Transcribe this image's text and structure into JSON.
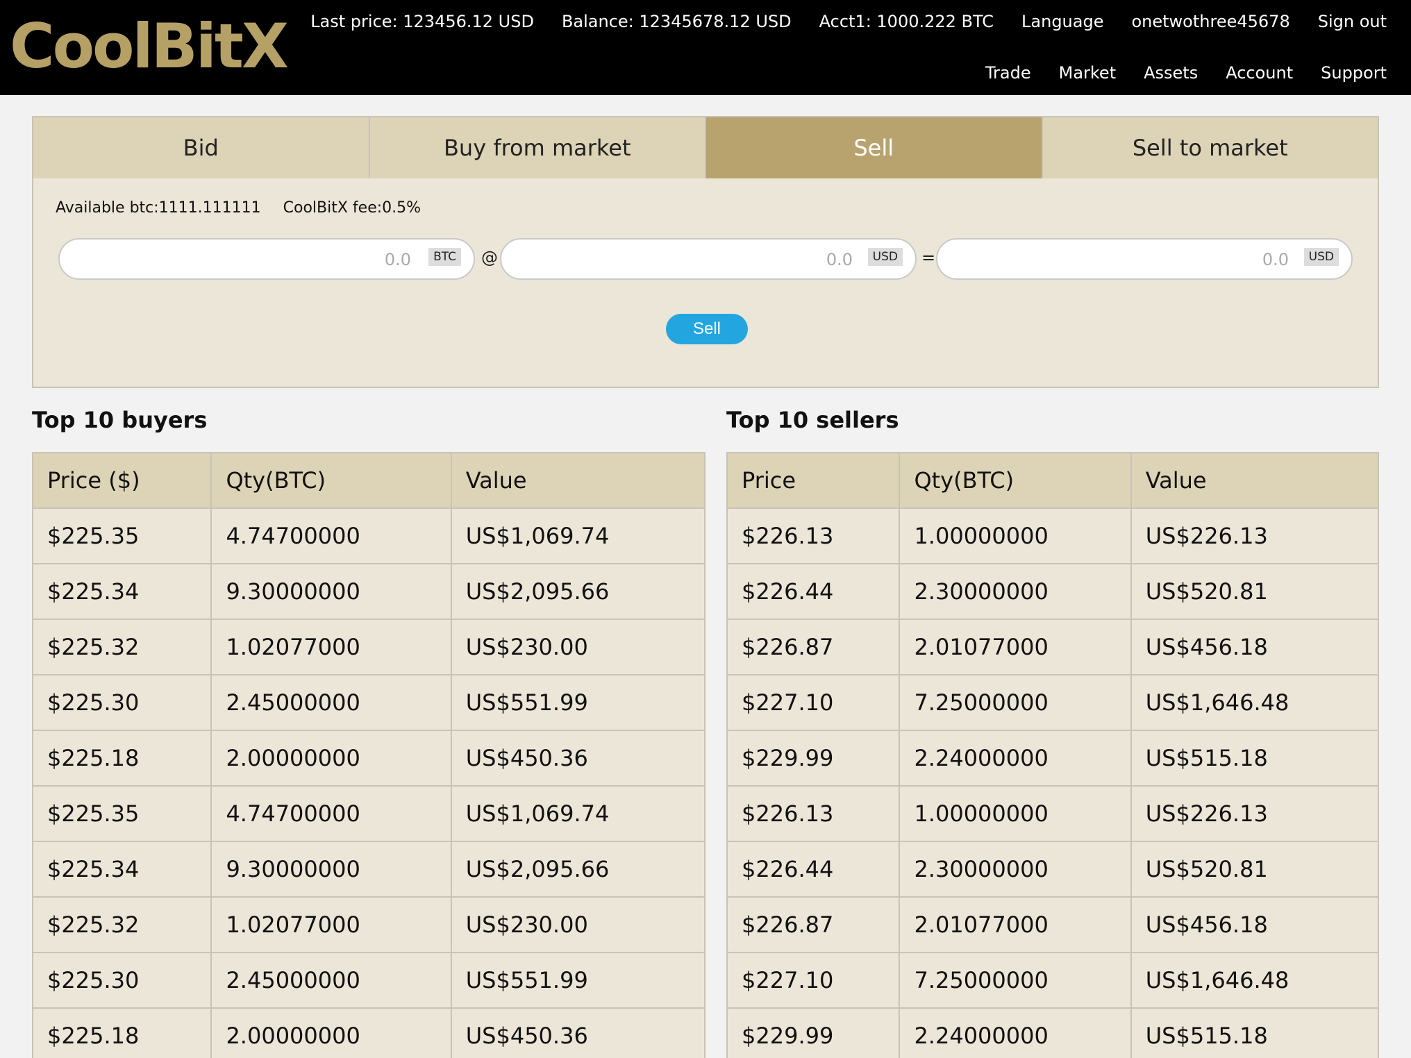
{
  "brand": {
    "logo": "CoolBitX"
  },
  "header": {
    "last_price": "Last price: 123456.12 USD",
    "balance": "Balance: 12345678.12 USD",
    "account": "Acct1: 1000.222 BTC",
    "language": "Language",
    "username": "onetwothree45678",
    "sign_out": "Sign out",
    "nav": [
      "Trade",
      "Market",
      "Assets",
      "Account",
      "Support"
    ]
  },
  "tabs": [
    "Bid",
    "Buy from market",
    "Sell",
    "Sell to market"
  ],
  "active_tab": "Sell",
  "form": {
    "available": "Available btc:1111.111111",
    "fee": "CoolBitX fee:0.5%",
    "amount_placeholder": "0.0",
    "amount_unit": "BTC",
    "at_symbol": "@",
    "price_placeholder": "0.0",
    "price_unit": "USD",
    "equals_symbol": "=",
    "total_placeholder": "0.0",
    "total_unit": "USD",
    "submit_label": "Sell"
  },
  "buyers": {
    "title": "Top 10 buyers",
    "headers": [
      "Price ($)",
      "Qty(BTC)",
      "Value"
    ],
    "rows": [
      [
        "$225.35",
        "4.74700000",
        "US$1,069.74"
      ],
      [
        "$225.34",
        "9.30000000",
        "US$2,095.66"
      ],
      [
        "$225.32",
        "1.02077000",
        "US$230.00"
      ],
      [
        "$225.30",
        "2.45000000",
        "US$551.99"
      ],
      [
        "$225.18",
        "2.00000000",
        "US$450.36"
      ],
      [
        "$225.35",
        "4.74700000",
        "US$1,069.74"
      ],
      [
        "$225.34",
        "9.30000000",
        "US$2,095.66"
      ],
      [
        "$225.32",
        "1.02077000",
        "US$230.00"
      ],
      [
        "$225.30",
        "2.45000000",
        "US$551.99"
      ],
      [
        "$225.18",
        "2.00000000",
        "US$450.36"
      ]
    ]
  },
  "sellers": {
    "title": "Top 10 sellers",
    "headers": [
      "Price",
      "Qty(BTC)",
      "Value"
    ],
    "rows": [
      [
        "$226.13",
        "1.00000000",
        "US$226.13"
      ],
      [
        "$226.44",
        "2.30000000",
        "US$520.81"
      ],
      [
        "$226.87",
        "2.01077000",
        "US$456.18"
      ],
      [
        "$227.10",
        "7.25000000",
        "US$1,646.48"
      ],
      [
        "$229.99",
        "2.24000000",
        "US$515.18"
      ],
      [
        "$226.13",
        "1.00000000",
        "US$226.13"
      ],
      [
        "$226.44",
        "2.30000000",
        "US$520.81"
      ],
      [
        "$226.87",
        "2.01077000",
        "US$456.18"
      ],
      [
        "$227.10",
        "7.25000000",
        "US$1,646.48"
      ],
      [
        "$229.99",
        "2.24000000",
        "US$515.18"
      ]
    ]
  },
  "colors": {
    "header_bg": "#000000",
    "logo": "#b5a066",
    "tab_bg": "#ddd4b8",
    "tab_active": "#b8a36e",
    "panel_bg": "#ece6d9",
    "button": "#23a6e0"
  }
}
